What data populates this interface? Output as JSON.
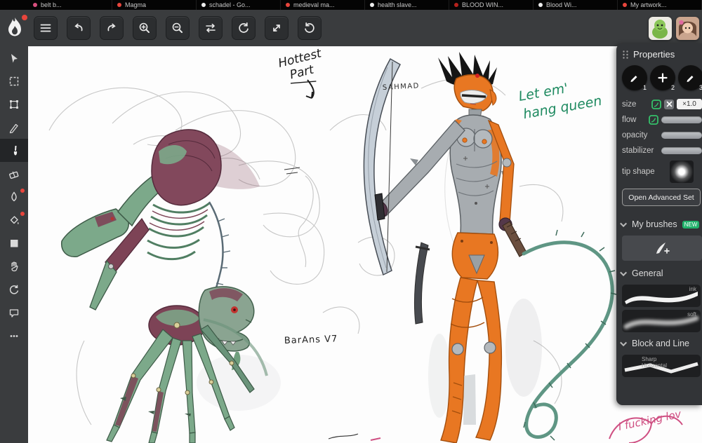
{
  "browser": {
    "tabs": [
      {
        "label": "belt b...",
        "color": "#d94f7e"
      },
      {
        "label": "Magma",
        "color": "#e8453c"
      },
      {
        "label": "schadel - Go...",
        "color": "#ededed"
      },
      {
        "label": "medieval ma...",
        "color": "#e8453c"
      },
      {
        "label": "health slave...",
        "color": "#ededed"
      },
      {
        "label": "BLOOD WIN...",
        "color": "#b5211c"
      },
      {
        "label": "Blood Wi...",
        "color": "#ededed"
      },
      {
        "label": "My artwork...",
        "color": "#e8453c"
      }
    ]
  },
  "toolbar": {
    "buttons": [
      "menu",
      "undo",
      "redo",
      "zoom-in",
      "zoom-out",
      "swap",
      "rotate-left",
      "resize",
      "reload"
    ]
  },
  "tools": [
    "move",
    "marquee-select",
    "transform",
    "pen",
    "brush",
    "eraser",
    "smudge",
    "fill",
    "shape",
    "hand",
    "reset-rotation",
    "comments",
    "more"
  ],
  "panel": {
    "title": "Properties",
    "slots": {
      "one": "1",
      "two": "2",
      "three": "3"
    },
    "rows": {
      "size": "size",
      "flow": "flow",
      "opacity": "opacity",
      "stabilizer": "stabilizer",
      "tip_shape": "tip shape"
    },
    "size_value": "×1.0",
    "advanced_button": "Open Advanced Set",
    "sections": {
      "my_brushes": "My brushes",
      "badge": "NEW",
      "general": "General",
      "block_line": "Block and Line"
    },
    "brushes": {
      "ink": "ink",
      "soft": "soft",
      "sharp": "Sharp Horizontal"
    }
  },
  "canvas": {
    "annotations": {
      "hottest_line1": "Hottest",
      "hottest_line2": "Part",
      "signature": "SAHMAD",
      "queen_line1": "Let em'",
      "queen_line2": "hang queen",
      "artist_tag": "BarAns V7",
      "pink_note": "I fucking lov"
    }
  }
}
